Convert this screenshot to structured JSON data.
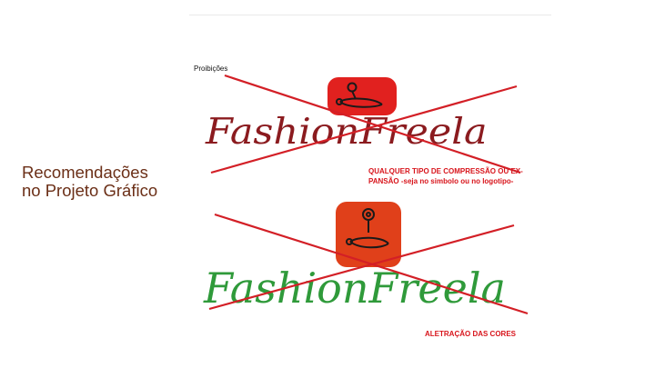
{
  "slide": {
    "title": "Recomendações no Projeto Gráfico",
    "title_color": "#6b2f17"
  },
  "section": {
    "label": "Proibições"
  },
  "examples": [
    {
      "wordmark": "FashionFreela",
      "wordmark_color": "#8b1b1f",
      "icon": "safety-pin-location-icon",
      "icon_bg": "#e1211f",
      "caption": "QUALQUER TIPO DE COMPRESSÃO OU EX-PANSÃO  -seja no simbolo ou no logotipo-"
    },
    {
      "wordmark": "FashionFreela",
      "wordmark_color": "#2f9a3a",
      "icon": "safety-pin-location-icon",
      "icon_bg": "#e0401a",
      "caption": "ALETRAÇÃO DAS CORES"
    }
  ],
  "strike_color": "#d31f26"
}
